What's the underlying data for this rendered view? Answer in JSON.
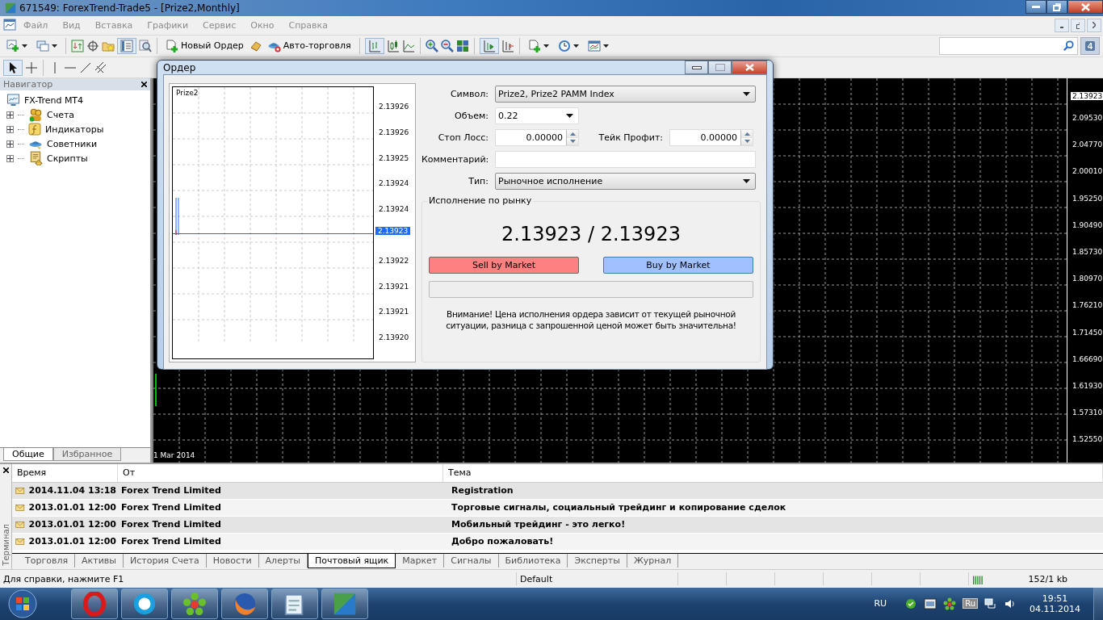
{
  "window": {
    "title": "671549: ForexTrend-Trade5 - [Prize2,Monthly]"
  },
  "menu": [
    "Файл",
    "Вид",
    "Вставка",
    "Графики",
    "Сервис",
    "Окно",
    "Справка"
  ],
  "toolbar": {
    "new_order": "Новый Ордер",
    "auto_trading": "Авто-торговля",
    "messages_badge": "4"
  },
  "navigator": {
    "title": "Навигатор",
    "root": {
      "label": "FX-Trend MT4",
      "children": [
        {
          "label": "Счета",
          "kind": "accounts",
          "expanded": false
        },
        {
          "label": "Индикаторы",
          "kind": "indicators",
          "expanded": false
        },
        {
          "label": "Советники",
          "kind": "experts",
          "expanded": false
        },
        {
          "label": "Скрипты",
          "kind": "scripts",
          "expanded": false
        }
      ]
    },
    "tabs": [
      {
        "label": "Общие",
        "selected": true
      },
      {
        "label": "Избранное",
        "selected": false
      }
    ]
  },
  "chart": {
    "current_price": "2.13923",
    "price_labels": [
      "2.09530",
      "2.04770",
      "2.00010",
      "1.95250",
      "1.90490",
      "1.85730",
      "1.80970",
      "1.76210",
      "1.71450",
      "1.66690",
      "1.61930",
      "1.57310",
      "1.52550"
    ],
    "date_label": "1 Mar 2014"
  },
  "order_dialog": {
    "title": "Ордер",
    "preview": {
      "symbol": "Prize2",
      "price_labels": [
        "2.13926",
        "2.13926",
        "2.13925",
        "2.13924",
        "2.13924",
        "2.13922",
        "2.13921",
        "2.13921",
        "2.13920"
      ],
      "current_price": "2.13923"
    },
    "symbol": {
      "label": "Символ:",
      "value": "Prize2, Prize2 PAMM Index"
    },
    "volume": {
      "label": "Объем:",
      "value": "0.22"
    },
    "stop_loss": {
      "label": "Стоп Лосс:",
      "value": "0.00000"
    },
    "take_profit": {
      "label": "Тейк Профит:",
      "value": "0.00000"
    },
    "comment": {
      "label": "Комментарий:"
    },
    "type": {
      "label": "Тип:",
      "value": "Рыночное исполнение"
    },
    "group_title": "Исполнение по рынку",
    "quote": "2.13923 / 2.13923",
    "sell_button": "Sell by Market",
    "buy_button": "Buy by Market",
    "progress": {
      "level": 0
    },
    "warning": "Внимание! Цена исполнения ордера зависит от текущей рыночной ситуации, разница с запрошенной ценой может быть значительна!"
  },
  "terminal": {
    "side_label": "Терминал",
    "columns": [
      "Время",
      "От",
      "Тема"
    ],
    "rows": [
      {
        "time": "2014.11.04 13:18",
        "from": "Forex Trend Limited",
        "subject": "Registration"
      },
      {
        "time": "2013.01.01 12:00",
        "from": "Forex Trend Limited",
        "subject": "Торговые сигналы, социальный трейдинг и копирование сделок"
      },
      {
        "time": "2013.01.01 12:00",
        "from": "Forex Trend Limited",
        "subject": "Мобильный трейдинг - это легко!"
      },
      {
        "time": "2013.01.01 12:00",
        "from": "Forex Trend Limited",
        "subject": "Добро пожаловать!"
      }
    ],
    "tabs": [
      {
        "label": "Торговля",
        "selected": false
      },
      {
        "label": "Активы",
        "selected": false
      },
      {
        "label": "История Счета",
        "selected": false
      },
      {
        "label": "Новости",
        "selected": false
      },
      {
        "label": "Алерты",
        "selected": false
      },
      {
        "label": "Почтовый ящик",
        "selected": true
      },
      {
        "label": "Маркет",
        "selected": false
      },
      {
        "label": "Сигналы",
        "selected": false
      },
      {
        "label": "Библиотека",
        "selected": false
      },
      {
        "label": "Эксперты",
        "selected": false
      },
      {
        "label": "Журнал",
        "selected": false
      }
    ]
  },
  "status_bar": {
    "help": "Для справки, нажмите F1",
    "profile": "Default",
    "traffic": "152/1 kb"
  },
  "taskbar": {
    "language": "RU",
    "tray_language": "Ru",
    "time": "19:51",
    "date": "04.11.2014"
  }
}
